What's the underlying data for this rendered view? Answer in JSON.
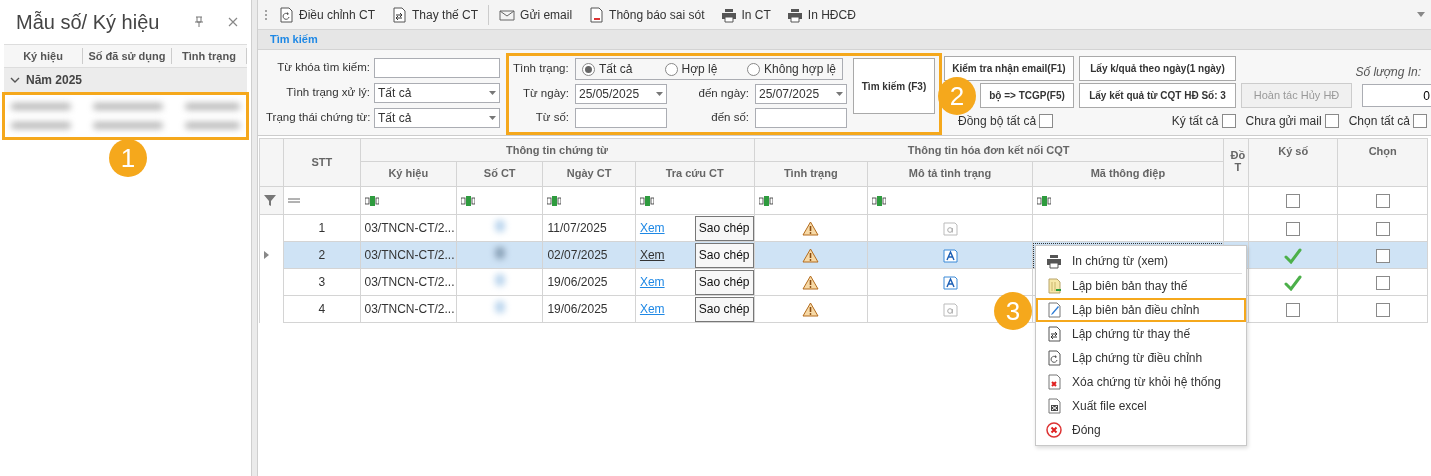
{
  "sidebar": {
    "title": "Mẫu số/ Ký hiệu",
    "columns": [
      "Ký hiệu",
      "Số đã sử dụng",
      "Tình trạng"
    ],
    "group": {
      "label": "Năm 2025",
      "expanded": true
    },
    "rows": [
      {
        "redacted": true
      },
      {
        "redacted": true
      }
    ],
    "highlighted": true,
    "callout": "1"
  },
  "toolbar": [
    {
      "label": "Điều chỉnh CT",
      "kind": "adjust"
    },
    {
      "label": "Thay thế CT",
      "kind": "replace"
    },
    {
      "label": "Gửi email",
      "kind": "email"
    },
    {
      "label": "Thông báo sai sót",
      "kind": "notice"
    },
    {
      "label": "In CT",
      "kind": "print"
    },
    {
      "label": "In HĐCĐ",
      "kind": "print"
    }
  ],
  "search": {
    "title": "Tìm kiếm",
    "fields": [
      {
        "label": "Từ khóa tìm kiếm:",
        "kind": "text"
      },
      {
        "label": "Tình trạng xử lý:",
        "kind": "select",
        "value": "Tất cả"
      },
      {
        "label": "Trạng thái chứng từ:",
        "kind": "select",
        "value": "Tất cả"
      }
    ],
    "status": {
      "label": "Tình trạng:",
      "options": [
        {
          "label": "Tất cả",
          "selected": true
        },
        {
          "label": "Hợp lệ",
          "selected": false
        },
        {
          "label": "Không hợp lệ",
          "selected": false
        }
      ]
    },
    "from_date": {
      "label": "Từ ngày:",
      "value": "25/05/2025"
    },
    "to_date": {
      "label": "đến ngày:",
      "value": "25/07/2025"
    },
    "from_no": {
      "label": "Từ số:"
    },
    "to_no": {
      "label": "đến số:"
    },
    "search_button": "Tìm kiếm (F3)",
    "highlighted": true,
    "callout": "2",
    "actions": [
      [
        {
          "label": "Kiểm tra nhận email(F1)",
          "disabled": false
        },
        {
          "label": "Lấy k/quả theo ngày(1 ngày)",
          "disabled": false
        }
      ],
      [
        {
          "label": "bộ => TCGP(F5)",
          "disabled": false
        },
        {
          "label": "Lấy kết quả từ CQT HĐ Số: 3",
          "disabled": false
        },
        {
          "label": "Hoàn tác Hủy HĐ",
          "disabled": true
        }
      ]
    ],
    "print_quantity": {
      "label": "Số lượng In:",
      "value": "0"
    },
    "sync_all": {
      "label": "Đồng bộ tất cả",
      "checked": false
    },
    "toggles": [
      {
        "label": "Ký tất cả",
        "checked": false
      },
      {
        "label": "Chưa gửi mail",
        "checked": false
      },
      {
        "label": "Chọn tất cả",
        "checked": false
      }
    ]
  },
  "grid": {
    "group_headers": [
      "Thông tin chứng từ",
      "Thông tin hóa đơn kết nối CQT"
    ],
    "columns": [
      "STT",
      "Ký hiệu",
      "Số CT",
      "Ngày CT",
      "Tra cứu CT",
      "Tình trạng",
      "Mô tả tình trạng",
      "Mã thông điệp",
      "Đồ T",
      "Ký số",
      "Chọn"
    ],
    "filter_checks": [
      {
        "checked": false
      },
      {
        "checked": false
      }
    ],
    "rows": [
      {
        "stt": "1",
        "ky_hieu": "03/TNCN-CT/2...",
        "so_ct_redacted": true,
        "ngay_ct": "11/07/2025",
        "link": "Xem",
        "copy": "Sao chép",
        "warning": true,
        "description_filled": false,
        "focused": false,
        "signed": false,
        "chosen": false,
        "selected": false
      },
      {
        "stt": "2",
        "ky_hieu": "03/TNCN-CT/2...",
        "so_ct_redacted": true,
        "ngay_ct": "02/07/2025",
        "link": "Xem",
        "copy": "Sao chép",
        "warning": true,
        "description_filled": true,
        "focused": true,
        "signed": true,
        "chosen": false,
        "selected": true
      },
      {
        "stt": "3",
        "ky_hieu": "03/TNCN-CT/2...",
        "so_ct_redacted": true,
        "ngay_ct": "19/06/2025",
        "link": "Xem",
        "copy": "Sao chép",
        "warning": true,
        "description_filled": true,
        "focused": false,
        "signed": true,
        "chosen": false,
        "selected": false
      },
      {
        "stt": "4",
        "ky_hieu": "03/TNCN-CT/2...",
        "so_ct_redacted": true,
        "ngay_ct": "19/06/2025",
        "link": "Xem",
        "copy": "Sao chép",
        "warning": true,
        "description_filled": false,
        "focused": false,
        "signed": false,
        "chosen": false,
        "selected": false
      }
    ]
  },
  "context_menu": {
    "items": [
      {
        "label": "In chứng từ (xem)",
        "kind": "print",
        "highlighted": false
      },
      {
        "label": "Lập biên bản thay thế",
        "kind": "minutes-replace",
        "highlighted": false
      },
      {
        "label": "Lập biên bản điều chỉnh",
        "kind": "minutes-adjust",
        "highlighted": true
      },
      {
        "label": "Lập chứng từ thay thế",
        "kind": "replace",
        "highlighted": false
      },
      {
        "label": "Lập chứng từ điều chỉnh",
        "kind": "adjust",
        "highlighted": false
      },
      {
        "label": "Xóa chứng từ khỏi hệ thống",
        "kind": "delete",
        "highlighted": false
      },
      {
        "label": "Xuất file excel",
        "kind": "excel",
        "highlighted": false
      },
      {
        "label": "Đóng",
        "kind": "close",
        "highlighted": false
      }
    ],
    "callout": "3"
  }
}
